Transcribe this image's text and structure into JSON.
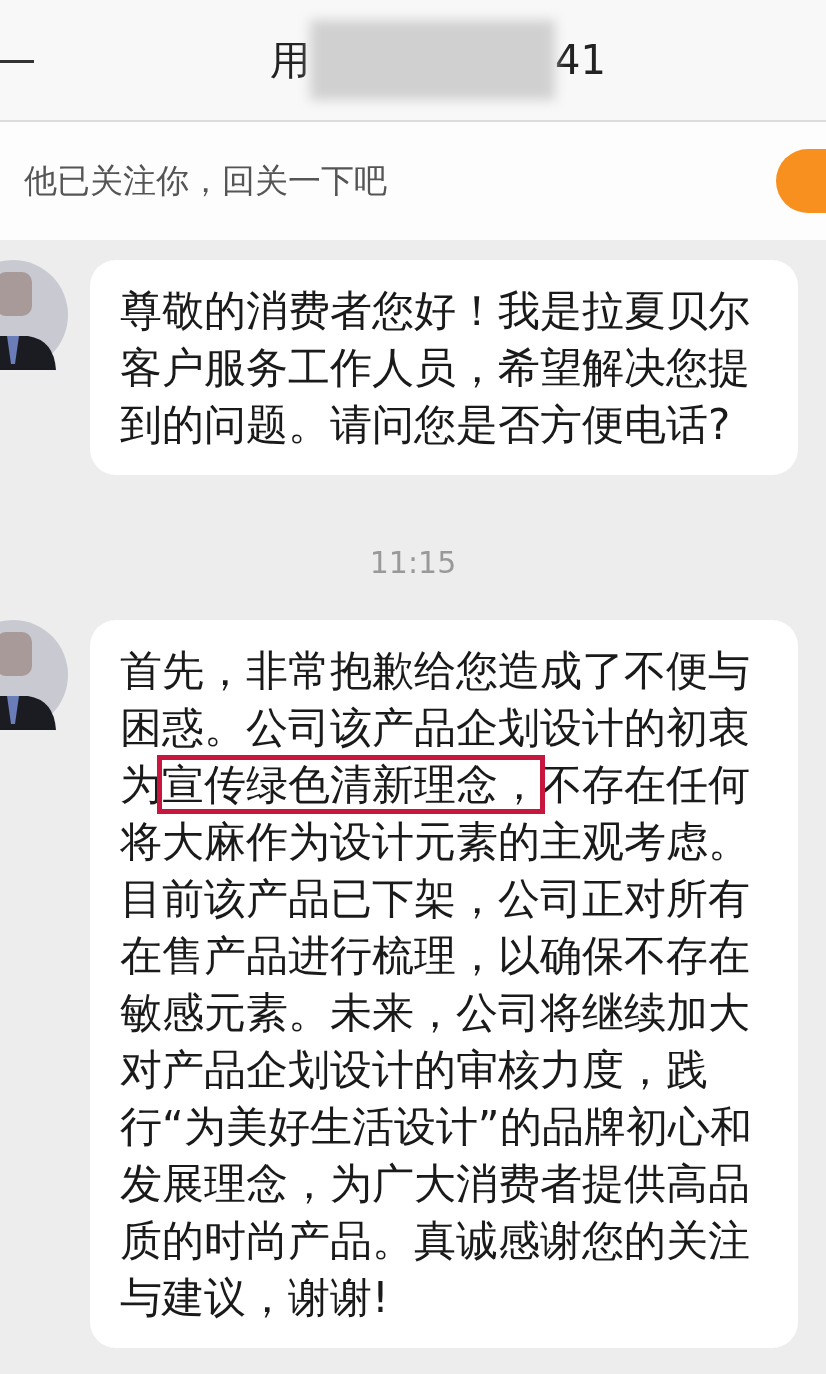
{
  "header": {
    "title_start": "用",
    "title_end": "41"
  },
  "follow_banner": {
    "text": "他已关注你，回关一下吧"
  },
  "messages": [
    {
      "kind": "plain",
      "text": "尊敬的消费者您好！我是拉夏贝尔客户服务工作人员，希望解决您提到的问题。请问您是否方便电话?"
    },
    {
      "kind": "time",
      "text": "11:15"
    },
    {
      "kind": "highlighted",
      "before": "首先，非常抱歉给您造成了不便与困惑。公司该产品企划设计的初衷为",
      "highlight": "宣传绿色清新理念，",
      "after": "不存在任何将大麻作为设计元素的主观考虑。目前该产品已下架，公司正对所有在售产品进行梳理，以确保不存在敏感元素。未来，公司将继续加大对产品企划设计的审核力度，践行“为美好生活设计”的品牌初心和发展理念，为广大消费者提供高品质的时尚产品。真诚感谢您的关注与建议，谢谢!"
    }
  ]
}
